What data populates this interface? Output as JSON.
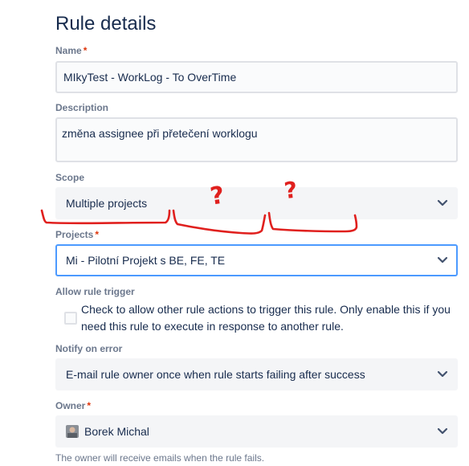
{
  "page": {
    "title": "Rule details"
  },
  "name": {
    "label": "Name",
    "required_mark": "*",
    "value": "MIkyTest - WorkLog - To OverTime"
  },
  "description": {
    "label": "Description",
    "value": "změna assignee při přetečení worklogu"
  },
  "scope": {
    "label": "Scope",
    "value": "Multiple projects"
  },
  "projects": {
    "label": "Projects",
    "required_mark": "*",
    "value": "Mi - Pilotní Projekt s BE, FE, TE"
  },
  "allow_trigger": {
    "label": "Allow rule trigger",
    "text": "Check to allow other rule actions to trigger this rule. Only enable this if you need this rule to execute in response to another rule.",
    "checked": false
  },
  "notify": {
    "label": "Notify on error",
    "value": "E-mail rule owner once when rule starts failing after success"
  },
  "owner": {
    "label": "Owner",
    "required_mark": "*",
    "value": "Borek Michal",
    "helper": "The owner will receive emails when the rule fails."
  },
  "annotations": {
    "marks": [
      "?",
      "?"
    ],
    "color": "#e0201e"
  },
  "colors": {
    "focus_border": "#4c9aff",
    "required": "#de350b",
    "label": "#6b778c"
  }
}
